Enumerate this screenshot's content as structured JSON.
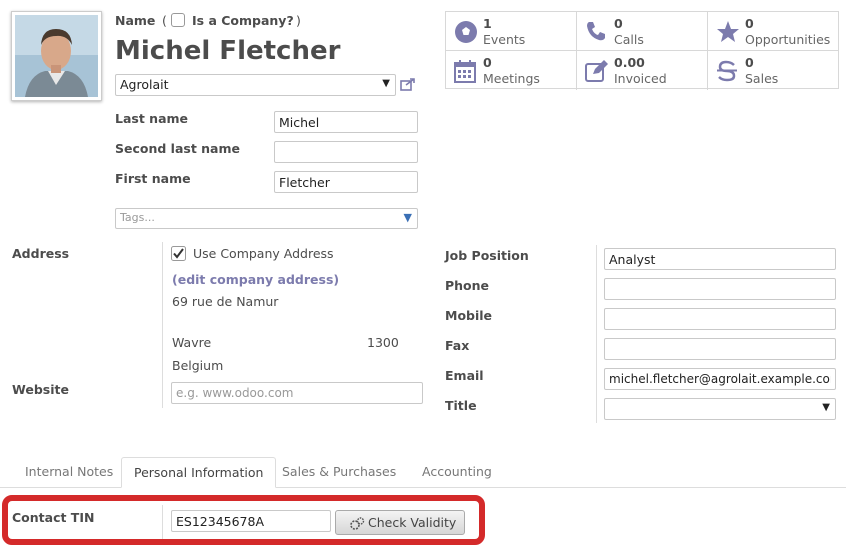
{
  "header": {
    "name_label": "Name",
    "paren_open": "(",
    "is_company_label": "Is a Company?",
    "paren_close": ")",
    "partner_name": "Michel Fletcher",
    "company": "Agrolait"
  },
  "name_fields": {
    "last_name_label": "Last name",
    "last_name_value": "Michel",
    "second_last_name_label": "Second last name",
    "second_last_name_value": "",
    "first_name_label": "First name",
    "first_name_value": "Fletcher",
    "tags_placeholder": "Tags..."
  },
  "stats": [
    {
      "count": "1",
      "label": "Events",
      "icon": "soccer-ball-icon"
    },
    {
      "count": "0",
      "label": "Calls",
      "icon": "phone-icon"
    },
    {
      "count": "0",
      "label": "Opportunities",
      "icon": "star-icon"
    },
    {
      "count": "0",
      "label": "Meetings",
      "icon": "calendar-icon"
    },
    {
      "count": "0.00",
      "label": "Invoiced",
      "icon": "pencil-square-icon"
    },
    {
      "count": "0",
      "label": "Sales",
      "icon": "dollar-icon"
    }
  ],
  "address": {
    "label": "Address",
    "use_company_address_label": "Use Company Address",
    "edit_company_link": "(edit company address)",
    "street": "69 rue de Namur",
    "city": "Wavre",
    "zip": "1300",
    "country": "Belgium",
    "website_label": "Website",
    "website_placeholder": "e.g. www.odoo.com"
  },
  "contact": {
    "job_position_label": "Job Position",
    "job_position_value": "Analyst",
    "phone_label": "Phone",
    "phone_value": "",
    "mobile_label": "Mobile",
    "mobile_value": "",
    "fax_label": "Fax",
    "fax_value": "",
    "email_label": "Email",
    "email_value": "michel.fletcher@agrolait.example.com",
    "title_label": "Title",
    "title_value": ""
  },
  "tabs": [
    "Internal Notes",
    "Personal Information",
    "Sales & Purchases",
    "Accounting"
  ],
  "personal": {
    "contact_tin_label": "Contact TIN",
    "contact_tin_value": "ES12345678A",
    "check_validity_label": "Check Validity"
  },
  "colors": {
    "highlight": "#d42a2a",
    "link": "#7c7bad",
    "icon": "#7c7bad"
  }
}
